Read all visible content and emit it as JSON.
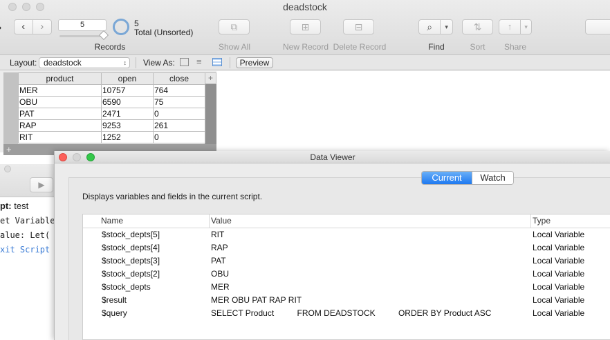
{
  "window": {
    "title": "deadstock"
  },
  "toolbar": {
    "records_value": "5",
    "records_label": "Records",
    "record_count": "5",
    "record_status": "Total (Unsorted)",
    "show_all": "Show All",
    "new_record": "New Record",
    "delete_record": "Delete Record",
    "find": "Find",
    "sort": "Sort",
    "share": "Share"
  },
  "layoutbar": {
    "layout_label": "Layout:",
    "layout_value": "deadstock",
    "view_as_label": "View As:",
    "preview": "Preview"
  },
  "table": {
    "headers": [
      "product",
      "open",
      "close"
    ],
    "rows": [
      [
        "MER",
        "10757",
        "764"
      ],
      [
        "OBU",
        "6590",
        "75"
      ],
      [
        "PAT",
        "2471",
        "0"
      ],
      [
        "RAP",
        "9253",
        "261"
      ],
      [
        "RIT",
        "1252",
        "0"
      ]
    ],
    "add_row": "+",
    "add_col": "+"
  },
  "debugger": {
    "script_label": "pt:",
    "script_name": "test",
    "lines": [
      "et Variable [",
      "alue: Let( [",
      "xit Script ["
    ]
  },
  "data_viewer": {
    "title": "Data Viewer",
    "tab_current": "Current",
    "tab_watch": "Watch",
    "description": "Displays variables and fields in the current script.",
    "columns": [
      "Name",
      "Value",
      "Type"
    ],
    "rows": [
      {
        "name": "$stock_depts[5]",
        "value": "RIT",
        "type": "Local Variable"
      },
      {
        "name": "$stock_depts[4]",
        "value": "RAP",
        "type": "Local Variable"
      },
      {
        "name": "$stock_depts[3]",
        "value": "PAT",
        "type": "Local Variable"
      },
      {
        "name": "$stock_depts[2]",
        "value": "OBU",
        "type": "Local Variable"
      },
      {
        "name": "$stock_depts",
        "value": "MER",
        "type": "Local Variable"
      },
      {
        "name": "$result",
        "value": "MER OBU PAT RAP RIT",
        "type": "Local Variable"
      },
      {
        "name": "$query",
        "value": "SELECT Product          FROM DEADSTOCK          ORDER BY Product ASC",
        "type": "Local Variable"
      }
    ]
  },
  "colors": {
    "accent": "#1e78f0",
    "close": "#fc605b",
    "minimize": "#d6d6d6",
    "zoom": "#34c84a"
  }
}
